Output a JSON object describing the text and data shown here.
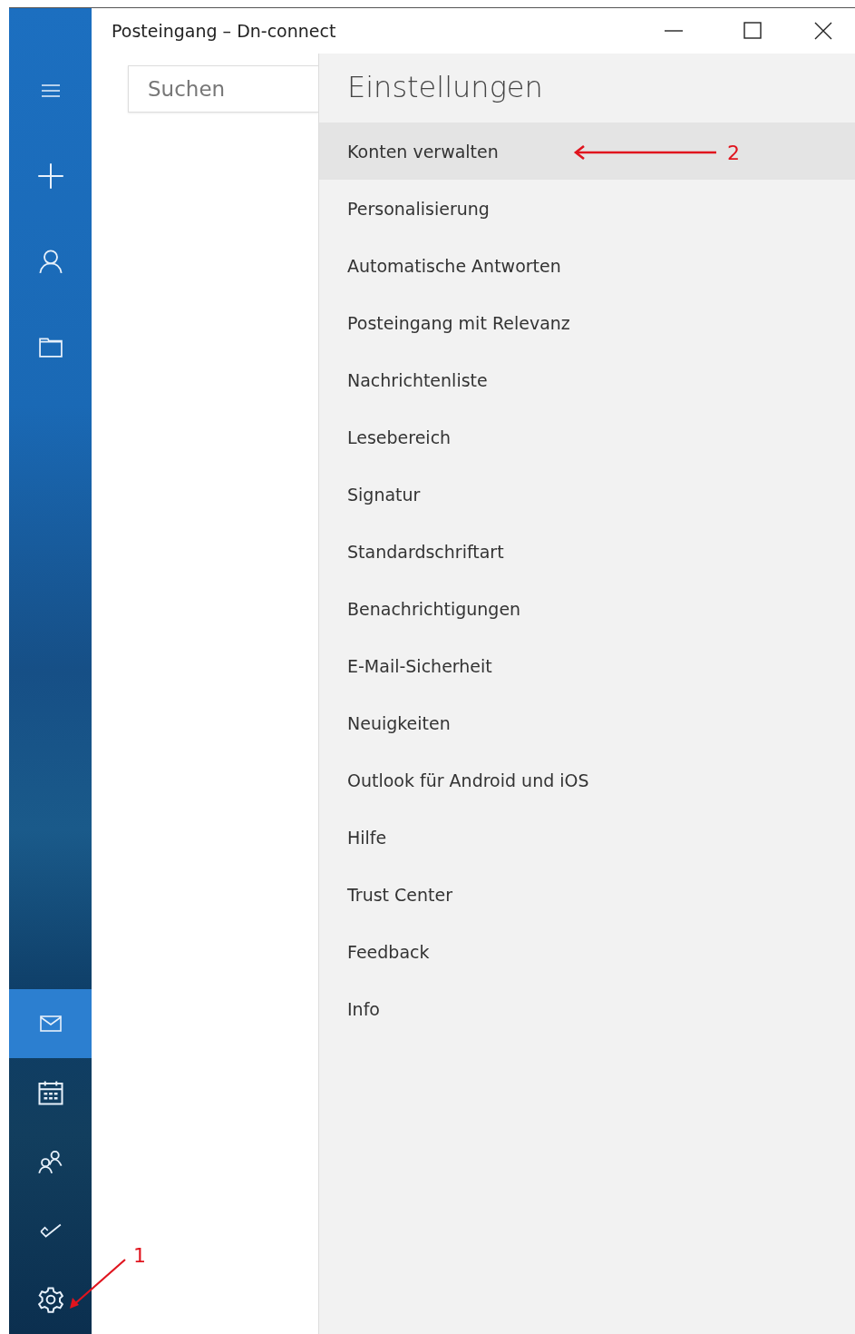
{
  "window": {
    "title": "Posteingang – Dn-connect",
    "controls": [
      {
        "kind": "minimize"
      },
      {
        "kind": "maximize"
      },
      {
        "kind": "close"
      }
    ]
  },
  "sidebar": {
    "top_items": [
      {
        "kind": "menu",
        "selected": false
      },
      {
        "kind": "compose",
        "selected": false
      },
      {
        "kind": "account",
        "selected": false
      },
      {
        "kind": "folders",
        "selected": false
      }
    ],
    "bottom_items": [
      {
        "kind": "mail",
        "selected": true
      },
      {
        "kind": "calendar",
        "selected": false
      },
      {
        "kind": "people",
        "selected": false
      },
      {
        "kind": "tasks",
        "selected": false
      },
      {
        "kind": "settings",
        "selected": false
      }
    ]
  },
  "search": {
    "placeholder": "Suchen"
  },
  "settings": {
    "title": "Einstellungen",
    "items": [
      {
        "label": "Konten verwalten",
        "selected": true
      },
      {
        "label": "Personalisierung",
        "selected": false
      },
      {
        "label": "Automatische Antworten",
        "selected": false
      },
      {
        "label": "Posteingang mit Relevanz",
        "selected": false
      },
      {
        "label": "Nachrichtenliste",
        "selected": false
      },
      {
        "label": "Lesebereich",
        "selected": false
      },
      {
        "label": "Signatur",
        "selected": false
      },
      {
        "label": "Standardschriftart",
        "selected": false
      },
      {
        "label": "Benachrichtigungen",
        "selected": false
      },
      {
        "label": "E-Mail-Sicherheit",
        "selected": false
      },
      {
        "label": "Neuigkeiten",
        "selected": false
      },
      {
        "label": "Outlook für Android und iOS",
        "selected": false
      },
      {
        "label": "Hilfe",
        "selected": false
      },
      {
        "label": "Trust Center",
        "selected": false
      },
      {
        "label": "Feedback",
        "selected": false
      },
      {
        "label": "Info",
        "selected": false
      }
    ]
  },
  "annotations": [
    {
      "label": "1",
      "kind": "diagonal"
    },
    {
      "label": "2",
      "kind": "horizontal"
    }
  ]
}
